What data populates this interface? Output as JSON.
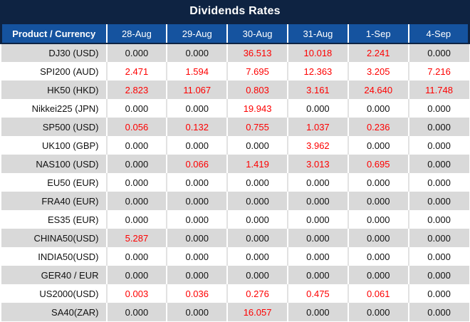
{
  "colors": {
    "title_bg": "#0e2342",
    "header_bg": "#15539f",
    "header_text": "#ffffff",
    "row_alt_bg": "#d9d9d9",
    "row_bg": "#ffffff",
    "value_black": "#111111",
    "value_red": "#fe0000",
    "light_divider": "#e2e2e2"
  },
  "chart_data": {
    "type": "table",
    "title": "Dividends Rates",
    "columns": [
      "Product / Currency",
      "28-Aug",
      "29-Aug",
      "30-Aug",
      "31-Aug",
      "1-Sep",
      "4-Sep"
    ],
    "rows": [
      {
        "product": "DJ30 (USD)",
        "values": [
          "0.000",
          "0.000",
          "36.513",
          "10.018",
          "2.241",
          "0.000"
        ],
        "red": [
          false,
          false,
          true,
          true,
          true,
          false
        ]
      },
      {
        "product": "SPI200 (AUD)",
        "values": [
          "2.471",
          "1.594",
          "7.695",
          "12.363",
          "3.205",
          "7.216"
        ],
        "red": [
          true,
          true,
          true,
          true,
          true,
          true
        ]
      },
      {
        "product": "HK50 (HKD)",
        "values": [
          "2.823",
          "11.067",
          "0.803",
          "3.161",
          "24.640",
          "11.748"
        ],
        "red": [
          true,
          true,
          true,
          true,
          true,
          true
        ]
      },
      {
        "product": "Nikkei225 (JPN)",
        "values": [
          "0.000",
          "0.000",
          "19.943",
          "0.000",
          "0.000",
          "0.000"
        ],
        "red": [
          false,
          false,
          true,
          false,
          false,
          false
        ]
      },
      {
        "product": "SP500 (USD)",
        "values": [
          "0.056",
          "0.132",
          "0.755",
          "1.037",
          "0.236",
          "0.000"
        ],
        "red": [
          true,
          true,
          true,
          true,
          true,
          false
        ]
      },
      {
        "product": "UK100 (GBP)",
        "values": [
          "0.000",
          "0.000",
          "0.000",
          "3.962",
          "0.000",
          "0.000"
        ],
        "red": [
          false,
          false,
          false,
          true,
          false,
          false
        ]
      },
      {
        "product": "NAS100 (USD)",
        "values": [
          "0.000",
          "0.066",
          "1.419",
          "3.013",
          "0.695",
          "0.000"
        ],
        "red": [
          false,
          true,
          true,
          true,
          true,
          false
        ]
      },
      {
        "product": "EU50 (EUR)",
        "values": [
          "0.000",
          "0.000",
          "0.000",
          "0.000",
          "0.000",
          "0.000"
        ],
        "red": [
          false,
          false,
          false,
          false,
          false,
          false
        ]
      },
      {
        "product": "FRA40 (EUR)",
        "values": [
          "0.000",
          "0.000",
          "0.000",
          "0.000",
          "0.000",
          "0.000"
        ],
        "red": [
          false,
          false,
          false,
          false,
          false,
          false
        ]
      },
      {
        "product": "ES35 (EUR)",
        "values": [
          "0.000",
          "0.000",
          "0.000",
          "0.000",
          "0.000",
          "0.000"
        ],
        "red": [
          false,
          false,
          false,
          false,
          false,
          false
        ]
      },
      {
        "product": "CHINA50(USD)",
        "values": [
          "5.287",
          "0.000",
          "0.000",
          "0.000",
          "0.000",
          "0.000"
        ],
        "red": [
          true,
          false,
          false,
          false,
          false,
          false
        ]
      },
      {
        "product": "INDIA50(USD)",
        "values": [
          "0.000",
          "0.000",
          "0.000",
          "0.000",
          "0.000",
          "0.000"
        ],
        "red": [
          false,
          false,
          false,
          false,
          false,
          false
        ]
      },
      {
        "product": "GER40 / EUR",
        "values": [
          "0.000",
          "0.000",
          "0.000",
          "0.000",
          "0.000",
          "0.000"
        ],
        "red": [
          false,
          false,
          false,
          false,
          false,
          false
        ]
      },
      {
        "product": "US2000(USD)",
        "values": [
          "0.003",
          "0.036",
          "0.276",
          "0.475",
          "0.061",
          "0.000"
        ],
        "red": [
          true,
          true,
          true,
          true,
          true,
          false
        ]
      },
      {
        "product": "SA40(ZAR)",
        "values": [
          "0.000",
          "0.000",
          "16.057",
          "0.000",
          "0.000",
          "0.000"
        ],
        "red": [
          false,
          false,
          true,
          false,
          false,
          false
        ]
      }
    ]
  }
}
